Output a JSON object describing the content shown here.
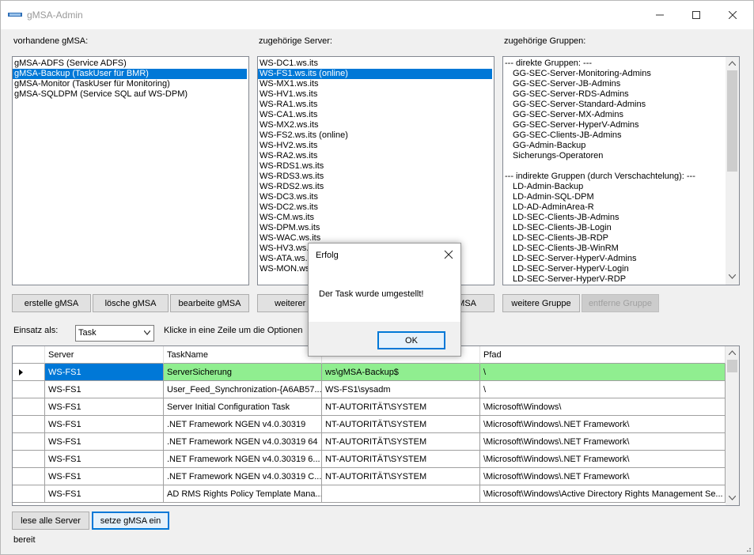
{
  "window": {
    "title": "gMSA-Admin"
  },
  "labels": {
    "gmsa": "vorhandene gMSA:",
    "server": "zugehörige Server:",
    "groups": "zugehörige Gruppen:",
    "einsatz": "Einsatz als:",
    "hint": "Klicke in eine Zeile um die Optionen"
  },
  "gmsa_list": [
    {
      "label": "gMSA-ADFS (Service ADFS)",
      "selected": false
    },
    {
      "label": "gMSA-Backup (TaskUser für BMR)",
      "selected": true
    },
    {
      "label": "gMSA-Monitor (TaskUser für Monitoring)",
      "selected": false
    },
    {
      "label": "gMSA-SQLDPM (Service SQL auf WS-DPM)",
      "selected": false
    }
  ],
  "server_list": [
    {
      "label": "WS-DC1.ws.its",
      "selected": false
    },
    {
      "label": "WS-FS1.ws.its (online)",
      "selected": true
    },
    {
      "label": "WS-MX1.ws.its",
      "selected": false
    },
    {
      "label": "WS-HV1.ws.its",
      "selected": false
    },
    {
      "label": "WS-RA1.ws.its",
      "selected": false
    },
    {
      "label": "WS-CA1.ws.its",
      "selected": false
    },
    {
      "label": "WS-MX2.ws.its",
      "selected": false
    },
    {
      "label": "WS-FS2.ws.its (online)",
      "selected": false
    },
    {
      "label": "WS-HV2.ws.its",
      "selected": false
    },
    {
      "label": "WS-RA2.ws.its",
      "selected": false
    },
    {
      "label": "WS-RDS1.ws.its",
      "selected": false
    },
    {
      "label": "WS-RDS3.ws.its",
      "selected": false
    },
    {
      "label": "WS-RDS2.ws.its",
      "selected": false
    },
    {
      "label": "WS-DC3.ws.its",
      "selected": false
    },
    {
      "label": "WS-DC2.ws.its",
      "selected": false
    },
    {
      "label": "WS-CM.ws.its",
      "selected": false
    },
    {
      "label": "WS-DPM.ws.its",
      "selected": false
    },
    {
      "label": "WS-WAC.ws.its",
      "selected": false
    },
    {
      "label": "WS-HV3.ws.its",
      "selected": false
    },
    {
      "label": "WS-ATA.ws.its",
      "selected": false
    },
    {
      "label": "WS-MON.ws.its",
      "selected": false
    }
  ],
  "group_list": [
    {
      "label": "--- direkte Gruppen: ---",
      "indent": false
    },
    {
      "label": "GG-SEC-Server-Monitoring-Admins",
      "indent": true
    },
    {
      "label": "GG-SEC-Server-JB-Admins",
      "indent": true
    },
    {
      "label": "GG-SEC-Server-RDS-Admins",
      "indent": true
    },
    {
      "label": "GG-SEC-Server-Standard-Admins",
      "indent": true
    },
    {
      "label": "GG-SEC-Server-MX-Admins",
      "indent": true
    },
    {
      "label": "GG-SEC-Server-HyperV-Admins",
      "indent": true
    },
    {
      "label": "GG-SEC-Clients-JB-Admins",
      "indent": true
    },
    {
      "label": "GG-Admin-Backup",
      "indent": true
    },
    {
      "label": "Sicherungs-Operatoren",
      "indent": true
    },
    {
      "label": "",
      "indent": false
    },
    {
      "label": "--- indirekte Gruppen (durch Verschachtelung): ---",
      "indent": false
    },
    {
      "label": "LD-Admin-Backup",
      "indent": true
    },
    {
      "label": "LD-Admin-SQL-DPM",
      "indent": true
    },
    {
      "label": "LD-AD-AdminArea-R",
      "indent": true
    },
    {
      "label": "LD-SEC-Clients-JB-Admins",
      "indent": true
    },
    {
      "label": "LD-SEC-Clients-JB-Login",
      "indent": true
    },
    {
      "label": "LD-SEC-Clients-JB-RDP",
      "indent": true
    },
    {
      "label": "LD-SEC-Clients-JB-WinRM",
      "indent": true
    },
    {
      "label": "LD-SEC-Server-HyperV-Admins",
      "indent": true
    },
    {
      "label": "LD-SEC-Server-HyperV-Login",
      "indent": true
    },
    {
      "label": "LD-SEC-Server-HyperV-RDP",
      "indent": true
    }
  ],
  "buttons": {
    "erstelle": "erstelle gMSA",
    "loesche": "lösche gMSA",
    "bearbeite": "bearbeite gMSA",
    "weiterer_server": "weiterer Se",
    "server_entfernen": "MSA",
    "weitere_gruppe": "weitere Gruppe",
    "entferne_gruppe": "entferne Gruppe",
    "lese_server": "lese alle Server",
    "setze_gmsa": "setze gMSA ein"
  },
  "einsatz_combo": {
    "value": "Task"
  },
  "grid": {
    "columns": [
      "Server",
      "TaskName",
      "",
      "Pfad"
    ],
    "rows": [
      {
        "server": "WS-FS1",
        "task": "ServerSicherung",
        "user": "ws\\gMSA-Backup$",
        "path": "\\",
        "highlight": true,
        "current": true
      },
      {
        "server": "WS-FS1",
        "task": "User_Feed_Synchronization-{A6AB57...",
        "user": "WS-FS1\\sysadm",
        "path": "\\",
        "highlight": false,
        "current": false
      },
      {
        "server": "WS-FS1",
        "task": "Server Initial Configuration Task",
        "user": "NT-AUTORITÄT\\SYSTEM",
        "path": "\\Microsoft\\Windows\\",
        "highlight": false,
        "current": false
      },
      {
        "server": "WS-FS1",
        "task": ".NET Framework NGEN v4.0.30319",
        "user": "NT-AUTORITÄT\\SYSTEM",
        "path": "\\Microsoft\\Windows\\.NET Framework\\",
        "highlight": false,
        "current": false
      },
      {
        "server": "WS-FS1",
        "task": ".NET Framework NGEN v4.0.30319 64",
        "user": "NT-AUTORITÄT\\SYSTEM",
        "path": "\\Microsoft\\Windows\\.NET Framework\\",
        "highlight": false,
        "current": false
      },
      {
        "server": "WS-FS1",
        "task": ".NET Framework NGEN v4.0.30319 6...",
        "user": "NT-AUTORITÄT\\SYSTEM",
        "path": "\\Microsoft\\Windows\\.NET Framework\\",
        "highlight": false,
        "current": false
      },
      {
        "server": "WS-FS1",
        "task": ".NET Framework NGEN v4.0.30319 C...",
        "user": "NT-AUTORITÄT\\SYSTEM",
        "path": "\\Microsoft\\Windows\\.NET Framework\\",
        "highlight": false,
        "current": false
      },
      {
        "server": "WS-FS1",
        "task": "AD RMS Rights Policy Template Mana...",
        "user": "",
        "path": "\\Microsoft\\Windows\\Active Directory Rights Management Se...",
        "highlight": false,
        "current": false
      }
    ]
  },
  "dialog": {
    "title": "Erfolg",
    "message": "Der Task wurde umgestellt!",
    "ok": "OK"
  },
  "status": "bereit",
  "colors": {
    "selection": "#0078d7",
    "highlight_row": "#90ee90",
    "button_face": "#e1e1e1"
  }
}
